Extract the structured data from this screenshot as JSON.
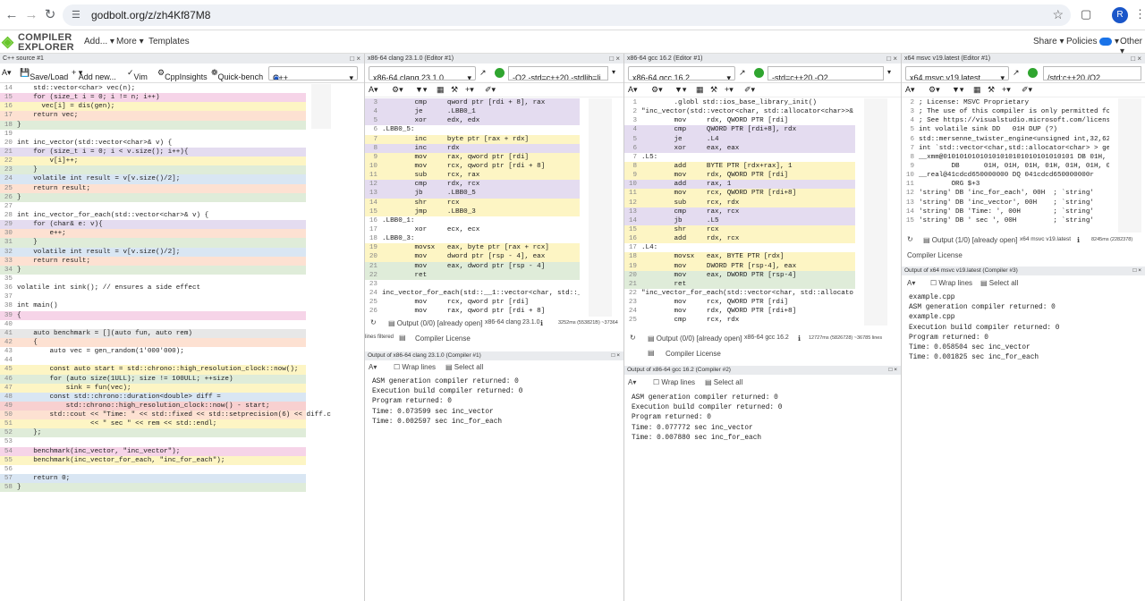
{
  "browser": {
    "url": "godbolt.org/z/zh4Kf87M8",
    "profile_initial": "R",
    "back_icon": "back-arrow-icon",
    "forward_icon": "forward-arrow-icon",
    "reload_icon": "reload-icon"
  },
  "ce": {
    "logo_line1": "COMPILER",
    "logo_line2": "EXPLORER",
    "menu_add": "Add...",
    "menu_more": "More",
    "menu_templates": "Templates",
    "menu_share": "Share",
    "menu_policies": "Policies",
    "menu_other": "Other",
    "brand_color": "#67c52a"
  },
  "source": {
    "tab": "C++ source #1",
    "save_load": "Save/Load",
    "add_new": "Add new...",
    "vim": "Vim",
    "cppinsights": "CppInsights",
    "quickbench": "Quick-bench",
    "language": "C++",
    "lines": [
      {
        "n": "14",
        "t": "    std::vector<char> vec(n);",
        "bg": "#ffffff"
      },
      {
        "n": "15",
        "t": "    for (size_t i = 0; i != n; i++)",
        "bg": "#f6d4e8"
      },
      {
        "n": "16",
        "t": "      vec[i] = dis(gen);",
        "bg": "#fdf5c4"
      },
      {
        "n": "17",
        "t": "    return vec;",
        "bg": "#fde1d2"
      },
      {
        "n": "18",
        "t": "}",
        "bg": "#dfecd9"
      },
      {
        "n": "19",
        "t": "",
        "bg": "#ffffff"
      },
      {
        "n": "20",
        "t": "int inc_vector(std::vector<char>& v) {",
        "bg": "#ffffff"
      },
      {
        "n": "21",
        "t": "    for (size_t i = 0; i < v.size(); i++){",
        "bg": "#e4dcf0"
      },
      {
        "n": "22",
        "t": "        v[i]++;",
        "bg": "#fdf5c4"
      },
      {
        "n": "23",
        "t": "    }",
        "bg": "#dfecd9"
      },
      {
        "n": "24",
        "t": "    volatile int result = v[v.size()/2];",
        "bg": "#d9e6f3"
      },
      {
        "n": "25",
        "t": "    return result;",
        "bg": "#fde1d2"
      },
      {
        "n": "26",
        "t": "}",
        "bg": "#dfecd9"
      },
      {
        "n": "27",
        "t": "",
        "bg": "#ffffff"
      },
      {
        "n": "28",
        "t": "int inc_vector_for_each(std::vector<char>& v) {",
        "bg": "#ffffff"
      },
      {
        "n": "29",
        "t": "    for (char& e: v){",
        "bg": "#e4dcf0"
      },
      {
        "n": "30",
        "t": "        e++;",
        "bg": "#fde1d2"
      },
      {
        "n": "31",
        "t": "    }",
        "bg": "#dfecd9"
      },
      {
        "n": "32",
        "t": "    volatile int result = v[v.size()/2];",
        "bg": "#d9e6f3"
      },
      {
        "n": "33",
        "t": "    return result;",
        "bg": "#fde1d2"
      },
      {
        "n": "34",
        "t": "}",
        "bg": "#dfecd9"
      },
      {
        "n": "35",
        "t": "",
        "bg": "#ffffff"
      },
      {
        "n": "36",
        "t": "volatile int sink(); // ensures a side effect",
        "bg": "#ffffff"
      },
      {
        "n": "37",
        "t": "",
        "bg": "#ffffff"
      },
      {
        "n": "38",
        "t": "int main()",
        "bg": "#ffffff"
      },
      {
        "n": "39",
        "t": "{",
        "bg": "#f6d4e8"
      },
      {
        "n": "40",
        "t": "",
        "bg": "#ffffff"
      },
      {
        "n": "41",
        "t": "    auto benchmark = [](auto fun, auto rem)",
        "bg": "#e7e7e7"
      },
      {
        "n": "42",
        "t": "    {",
        "bg": "#fde1d2"
      },
      {
        "n": "43",
        "t": "        auto vec = gen_random(1'000'000);",
        "bg": "#ffffff"
      },
      {
        "n": "44",
        "t": "",
        "bg": "#ffffff"
      },
      {
        "n": "45",
        "t": "        const auto start = std::chrono::high_resolution_clock::now();",
        "bg": "#fdf5c4"
      },
      {
        "n": "46",
        "t": "        for (auto size(1ULL); size != 100ULL; ++size)",
        "bg": "#dfecd9"
      },
      {
        "n": "47",
        "t": "            sink = fun(vec);",
        "bg": "#fdf5c4"
      },
      {
        "n": "48",
        "t": "        const std::chrono::duration<double> diff =",
        "bg": "#d9e6f3"
      },
      {
        "n": "49",
        "t": "            std::chrono::high_resolution_clock::now() - start;",
        "bg": "#f8d0d0"
      },
      {
        "n": "50",
        "t": "        std::cout << \"Time: \" << std::fixed << std::setprecision(6) << diff.c",
        "bg": "#fde1d2"
      },
      {
        "n": "51",
        "t": "                  << \" sec \" << rem << std::endl;",
        "bg": "#fdf5c4"
      },
      {
        "n": "52",
        "t": "    };",
        "bg": "#dfecd9"
      },
      {
        "n": "53",
        "t": "",
        "bg": "#ffffff"
      },
      {
        "n": "54",
        "t": "    benchmark(inc_vector, \"inc_vector\");",
        "bg": "#f6d4e8"
      },
      {
        "n": "55",
        "t": "    benchmark(inc_vector_for_each, \"inc_for_each\");",
        "bg": "#fdf5c4"
      },
      {
        "n": "56",
        "t": "",
        "bg": "#ffffff"
      },
      {
        "n": "57",
        "t": "    return 0;",
        "bg": "#d9e6f3"
      },
      {
        "n": "58",
        "t": "}",
        "bg": "#dfecd9"
      }
    ]
  },
  "clang": {
    "tab": "x86-64 clang 23.1.0 (Editor #1)",
    "compiler": "x86-64 clang 23.1.0",
    "options": "-O2 -std=c++20 -stdlib=li",
    "lines": [
      {
        "n": "3",
        "t": "        cmp     qword ptr [rdi + 8], rax",
        "bg": "#e4dcf0"
      },
      {
        "n": "4",
        "t": "        je      .LBB0_1",
        "bg": "#e4dcf0"
      },
      {
        "n": "5",
        "t": "        xor     edx, edx",
        "bg": "#e4dcf0"
      },
      {
        "n": "6",
        "t": ".LBB0_5:",
        "bg": "#ffffff"
      },
      {
        "n": "7",
        "t": "        inc     byte ptr [rax + rdx]",
        "bg": "#fdf5c4"
      },
      {
        "n": "8",
        "t": "        inc     rdx",
        "bg": "#e4dcf0"
      },
      {
        "n": "9",
        "t": "        mov     rax, qword ptr [rdi]",
        "bg": "#fdf5c4"
      },
      {
        "n": "10",
        "t": "        mov     rcx, qword ptr [rdi + 8]",
        "bg": "#fdf5c4"
      },
      {
        "n": "11",
        "t": "        sub     rcx, rax",
        "bg": "#fdf5c4"
      },
      {
        "n": "12",
        "t": "        cmp     rdx, rcx",
        "bg": "#e4dcf0"
      },
      {
        "n": "13",
        "t": "        jb      .LBB0_5",
        "bg": "#e4dcf0"
      },
      {
        "n": "14",
        "t": "        shr     rcx",
        "bg": "#fdf5c4"
      },
      {
        "n": "15",
        "t": "        jmp     .LBB0_3",
        "bg": "#fdf5c4"
      },
      {
        "n": "16",
        "t": ".LBB0_1:",
        "bg": "#ffffff"
      },
      {
        "n": "17",
        "t": "        xor     ecx, ecx",
        "bg": "#ffffff"
      },
      {
        "n": "18",
        "t": ".LBB0_3:",
        "bg": "#ffffff"
      },
      {
        "n": "19",
        "t": "        movsx   eax, byte ptr [rax + rcx]",
        "bg": "#fdf5c4"
      },
      {
        "n": "20",
        "t": "        mov     dword ptr [rsp - 4], eax",
        "bg": "#fdf5c4"
      },
      {
        "n": "21",
        "t": "        mov     eax, dword ptr [rsp - 4]",
        "bg": "#dfecd9"
      },
      {
        "n": "22",
        "t": "        ret",
        "bg": "#dfecd9"
      },
      {
        "n": "23",
        "t": "",
        "bg": "#ffffff"
      },
      {
        "n": "24",
        "t": "inc_vector_for_each(std::__1::vector<char, std::__",
        "bg": "#ffffff"
      },
      {
        "n": "25",
        "t": "        mov     rcx, qword ptr [rdi]",
        "bg": "#ffffff"
      },
      {
        "n": "26",
        "t": "        mov     rax, qword ptr [rdi + 8]",
        "bg": "#ffffff"
      }
    ],
    "status_output": "Output (0/0) [already open]",
    "status_compiler": "x86-64 clang 23.1.0",
    "status_time": "3252ms (553821B) ~37364",
    "lines_filtered": "lines filtered",
    "license": "Compiler License",
    "out_tab": "Output of x86-64 clang 23.1.0 (Compiler #1)",
    "wrap": "Wrap lines",
    "select_all": "Select all",
    "output": [
      "ASM generation compiler returned: 0",
      "Execution build compiler returned: 0",
      "Program returned: 0",
      "Time: 0.073599 sec inc_vector",
      "Time: 0.002597 sec inc_for_each"
    ]
  },
  "gcc": {
    "tab": "x86-64 gcc 16.2 (Editor #1)",
    "compiler": "x86-64 gcc 16.2",
    "options": "-std=c++20 -O2",
    "lines": [
      {
        "n": "1",
        "t": "        .globl std::ios_base_library_init()",
        "bg": "#ffffff"
      },
      {
        "n": "2",
        "t": "\"inc_vector(std::vector<char, std::allocator<char>>&",
        "bg": "#ffffff"
      },
      {
        "n": "3",
        "t": "        mov     rdx, QWORD PTR [rdi]",
        "bg": "#ffffff"
      },
      {
        "n": "4",
        "t": "        cmp     QWORD PTR [rdi+8], rdx",
        "bg": "#e4dcf0"
      },
      {
        "n": "5",
        "t": "        je      .L4",
        "bg": "#e4dcf0"
      },
      {
        "n": "6",
        "t": "        xor     eax, eax",
        "bg": "#e4dcf0"
      },
      {
        "n": "7",
        "t": ".L5:",
        "bg": "#ffffff"
      },
      {
        "n": "8",
        "t": "        add     BYTE PTR [rdx+rax], 1",
        "bg": "#fdf5c4"
      },
      {
        "n": "9",
        "t": "        mov     rdx, QWORD PTR [rdi]",
        "bg": "#fdf5c4"
      },
      {
        "n": "10",
        "t": "        add     rax, 1",
        "bg": "#e4dcf0"
      },
      {
        "n": "11",
        "t": "        mov     rcx, QWORD PTR [rdi+8]",
        "bg": "#fdf5c4"
      },
      {
        "n": "12",
        "t": "        sub     rcx, rdx",
        "bg": "#fdf5c4"
      },
      {
        "n": "13",
        "t": "        cmp     rax, rcx",
        "bg": "#e4dcf0"
      },
      {
        "n": "14",
        "t": "        jb      .L5",
        "bg": "#e4dcf0"
      },
      {
        "n": "15",
        "t": "        shr     rcx",
        "bg": "#fdf5c4"
      },
      {
        "n": "16",
        "t": "        add     rdx, rcx",
        "bg": "#fdf5c4"
      },
      {
        "n": "17",
        "t": ".L4:",
        "bg": "#ffffff"
      },
      {
        "n": "18",
        "t": "        movsx   eax, BYTE PTR [rdx]",
        "bg": "#fdf5c4"
      },
      {
        "n": "19",
        "t": "        mov     DWORD PTR [rsp-4], eax",
        "bg": "#fdf5c4"
      },
      {
        "n": "20",
        "t": "        mov     eax, DWORD PTR [rsp-4]",
        "bg": "#dfecd9"
      },
      {
        "n": "21",
        "t": "        ret",
        "bg": "#dfecd9"
      },
      {
        "n": "22",
        "t": "\"inc_vector_for_each(std::vector<char, std::allocato",
        "bg": "#ffffff"
      },
      {
        "n": "23",
        "t": "        mov     rcx, QWORD PTR [rdi]",
        "bg": "#ffffff"
      },
      {
        "n": "24",
        "t": "        mov     rdx, QWORD PTR [rdi+8]",
        "bg": "#ffffff"
      },
      {
        "n": "25",
        "t": "        cmp     rcx, rdx",
        "bg": "#ffffff"
      }
    ],
    "status_output": "Output (0/0) [already open]",
    "status_compiler": "x86-64 gcc 16.2",
    "status_time": "12727ms (5826728) ~36785 lines",
    "license": "Compiler License",
    "out_tab": "Output of x86-64 gcc 16.2 (Compiler #2)",
    "wrap": "Wrap lines",
    "select_all": "Select all",
    "output": [
      "ASM generation compiler returned: 0",
      "Execution build compiler returned: 0",
      "Program returned: 0",
      "Time: 0.077772 sec inc_vector",
      "Time: 0.007880 sec inc_for_each"
    ]
  },
  "msvc": {
    "tab": "x64 msvc v19.latest (Editor #1)",
    "compiler": "x64 msvc v19.latest",
    "options": "/std:c++20 /O2",
    "lines": [
      {
        "n": "2",
        "t": "; License: MSVC Proprietary",
        "bg": "#ffffff"
      },
      {
        "n": "3",
        "t": "; The use of this compiler is only permitted for",
        "bg": "#ffffff"
      },
      {
        "n": "4",
        "t": "; See https://visualstudio.microsoft.com/license",
        "bg": "#ffffff"
      },
      {
        "n": "5",
        "t": "int volatile sink DD   01H DUP (?)",
        "bg": "#ffffff"
      },
      {
        "n": "6",
        "t": "std::mersenne_twister_engine<unsigned int,32,624",
        "bg": "#ffffff"
      },
      {
        "n": "7",
        "t": "int `std::vector<char,std::allocator<char> > gen",
        "bg": "#ffffff"
      },
      {
        "n": "8",
        "t": "__xmm@01010101010101010101010101010101 DB 01H, 0",
        "bg": "#ffffff"
      },
      {
        "n": "9",
        "t": "        DB      01H, 01H, 01H, 01H, 01H, 01H, 01",
        "bg": "#ffffff"
      },
      {
        "n": "10",
        "t": "__real@41cdcd650000000 DQ 041cdcd650000000r",
        "bg": "#ffffff"
      },
      {
        "n": "11",
        "t": "        ORG $+3",
        "bg": "#ffffff"
      },
      {
        "n": "12",
        "t": "'string' DB 'inc_for_each', 00H  ; `string'",
        "bg": "#ffffff"
      },
      {
        "n": "13",
        "t": "'string' DB 'inc_vector', 00H    ; `string'",
        "bg": "#ffffff"
      },
      {
        "n": "14",
        "t": "'string' DB 'Time: ', 00H        ; `string'",
        "bg": "#ffffff"
      },
      {
        "n": "15",
        "t": "'string' DB ' sec ', 00H         ; `string'",
        "bg": "#ffffff"
      }
    ],
    "status_output": "Output (1/0) [already open]",
    "status_compiler": "x64 msvc v19.latest",
    "status_time": "8245ms (2282378)",
    "license": "Compiler License",
    "out_tab": "Output of x64 msvc v19.latest (Compiler #3)",
    "wrap": "Wrap lines",
    "select_all": "Select all",
    "output": [
      "example.cpp",
      "ASM generation compiler returned: 0",
      "example.cpp",
      "Execution build compiler returned: 0",
      "Program returned: 0",
      "Time: 0.058504 sec inc_vector",
      "Time: 0.001825 sec inc_for_each"
    ]
  }
}
